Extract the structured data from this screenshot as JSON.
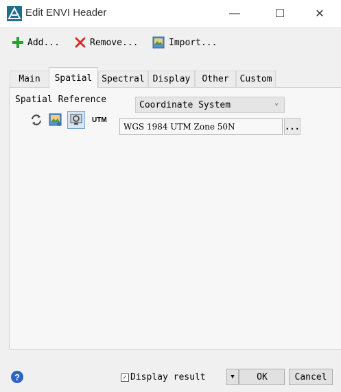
{
  "window": {
    "title": "Edit ENVI Header",
    "minimize_glyph": "—",
    "maximize_glyph": "☐",
    "close_glyph": "✕"
  },
  "toolbar": {
    "add_label": "Add...",
    "remove_label": "Remove...",
    "import_label": "Import..."
  },
  "tabs": [
    {
      "label": "Main"
    },
    {
      "label": "Spatial"
    },
    {
      "label": "Spectral"
    },
    {
      "label": "Display"
    },
    {
      "label": "Other"
    },
    {
      "label": "Custom"
    }
  ],
  "active_tab": "Spatial",
  "spatial": {
    "reference_label": "Spatial Reference",
    "utm_label": "UTM",
    "coordinate_select": "Coordinate System",
    "projection_value": "WGS 1984 UTM Zone 50N",
    "browse_label": "..."
  },
  "footer": {
    "help_glyph": "?",
    "display_result_label": "Display result",
    "display_result_checked": true,
    "check_glyph": "✓",
    "dropdown_glyph": "▼",
    "ok_label": "OK",
    "cancel_label": "Cancel"
  },
  "colors": {
    "accent_blue": "#2d63c8",
    "add_green": "#2aa22a",
    "remove_red": "#d42b2b"
  }
}
